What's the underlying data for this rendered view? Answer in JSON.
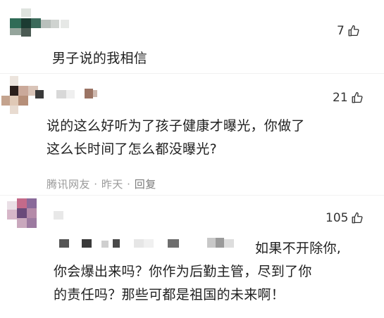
{
  "comments": [
    {
      "likes": "7",
      "text": "男子说的我相信"
    },
    {
      "likes": "21",
      "line1": "说的这么好听为了孩子健康才曝光，你做了",
      "line2": "这么长时间了怎么都没曝光?",
      "meta": {
        "source": "腾讯网友",
        "time": "昨天",
        "reply": "回复"
      }
    },
    {
      "likes": "105",
      "line1": "如果不开除你,",
      "line2": "你会爆出来吗？你作为后勤主管，尽到了你",
      "line3": "的责任吗？那些可都是祖国的未来啊！"
    }
  ],
  "colors": {
    "text": "#1f1f1f",
    "meta": "#9a9a9a",
    "like_icon": "#333333"
  },
  "icons": {
    "like": "thumbs-up-outline-icon"
  }
}
